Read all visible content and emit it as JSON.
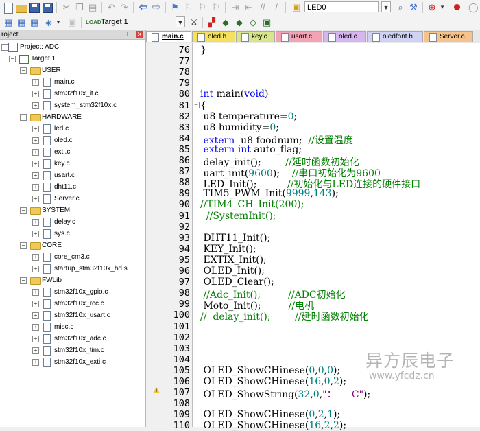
{
  "toolbar": {
    "target_name": "Target 1",
    "run_config": "LED0"
  },
  "project_panel": {
    "title": "roject",
    "pin": "📌",
    "close": "✕",
    "tree": [
      {
        "label": "Project: ADC",
        "kind": "project"
      },
      {
        "label": "Target 1",
        "kind": "target"
      },
      {
        "label": "USER",
        "kind": "folder"
      },
      {
        "label": "main.c",
        "kind": "file"
      },
      {
        "label": "stm32f10x_it.c",
        "kind": "file"
      },
      {
        "label": "system_stm32f10x.c",
        "kind": "file"
      },
      {
        "label": "HARDWARE",
        "kind": "folder"
      },
      {
        "label": "led.c",
        "kind": "file"
      },
      {
        "label": "oled.c",
        "kind": "file"
      },
      {
        "label": "exti.c",
        "kind": "file"
      },
      {
        "label": "key.c",
        "kind": "file"
      },
      {
        "label": "usart.c",
        "kind": "file"
      },
      {
        "label": "dht11.c",
        "kind": "file"
      },
      {
        "label": "Server.c",
        "kind": "file"
      },
      {
        "label": "SYSTEM",
        "kind": "folder"
      },
      {
        "label": "delay.c",
        "kind": "file"
      },
      {
        "label": "sys.c",
        "kind": "file"
      },
      {
        "label": "CORE",
        "kind": "folder"
      },
      {
        "label": "core_cm3.c",
        "kind": "file"
      },
      {
        "label": "startup_stm32f10x_hd.s",
        "kind": "file"
      },
      {
        "label": "FWLib",
        "kind": "folder"
      },
      {
        "label": "stm32f10x_gpio.c",
        "kind": "file"
      },
      {
        "label": "stm32f10x_rcc.c",
        "kind": "file"
      },
      {
        "label": "stm32f10x_usart.c",
        "kind": "file"
      },
      {
        "label": "misc.c",
        "kind": "file"
      },
      {
        "label": "stm32f10x_adc.c",
        "kind": "file"
      },
      {
        "label": "stm32f10x_tim.c",
        "kind": "file"
      },
      {
        "label": "stm32f10x_exti.c",
        "kind": "file"
      }
    ]
  },
  "tabs": [
    {
      "label": "main.c",
      "color": "#f5c97a",
      "active": true
    },
    {
      "label": "oled.h",
      "color": "#f5e15e",
      "active": false
    },
    {
      "label": "key.c",
      "color": "#d8e58a",
      "active": false
    },
    {
      "label": "usart.c",
      "color": "#f3a3b4",
      "active": false
    },
    {
      "label": "oled.c",
      "color": "#d6b6ee",
      "active": false
    },
    {
      "label": "oledfont.h",
      "color": "#cfd2f2",
      "active": false
    },
    {
      "label": "Server.c",
      "color": "#f6c48a",
      "active": false
    }
  ],
  "editor": {
    "lines": [
      {
        "n": "76",
        "segs": [
          {
            "t": "}",
            "c": ""
          }
        ]
      },
      {
        "n": "77",
        "segs": []
      },
      {
        "n": "78",
        "segs": []
      },
      {
        "n": "79",
        "segs": []
      },
      {
        "n": "80",
        "segs": [
          {
            "t": "int",
            "c": "k"
          },
          {
            "t": " main(",
            "c": ""
          },
          {
            "t": "void",
            "c": "k"
          },
          {
            "t": ")",
            "c": ""
          }
        ]
      },
      {
        "n": "81",
        "segs": [
          {
            "t": "{",
            "c": ""
          }
        ]
      },
      {
        "n": "82",
        "segs": [
          {
            "t": " u8 temperature=",
            "c": ""
          },
          {
            "t": "0",
            "c": "n"
          },
          {
            "t": ";",
            "c": ""
          }
        ]
      },
      {
        "n": "83",
        "segs": [
          {
            "t": " u8 humidity=",
            "c": ""
          },
          {
            "t": "0",
            "c": "n"
          },
          {
            "t": ";",
            "c": ""
          }
        ]
      },
      {
        "n": "84",
        "segs": [
          {
            "t": " ",
            "c": ""
          },
          {
            "t": "extern",
            "c": "k"
          },
          {
            "t": "  u8 foodnum;  ",
            "c": ""
          },
          {
            "t": "//设置温度",
            "c": "c"
          }
        ]
      },
      {
        "n": "85",
        "segs": [
          {
            "t": " ",
            "c": ""
          },
          {
            "t": "extern",
            "c": "k"
          },
          {
            "t": " ",
            "c": ""
          },
          {
            "t": "int",
            "c": "k"
          },
          {
            "t": " auto_flag;",
            "c": ""
          }
        ]
      },
      {
        "n": "86",
        "segs": [
          {
            "t": " delay_init();        ",
            "c": ""
          },
          {
            "t": "//延时函数初始化",
            "c": "c"
          }
        ]
      },
      {
        "n": "87",
        "segs": [
          {
            "t": " uart_init(",
            "c": ""
          },
          {
            "t": "9600",
            "c": "n"
          },
          {
            "t": ");    ",
            "c": ""
          },
          {
            "t": "//串口初始化为9600",
            "c": "c"
          }
        ]
      },
      {
        "n": "88",
        "segs": [
          {
            "t": " LED_Init();          ",
            "c": ""
          },
          {
            "t": "//初始化与LED连接的硬件接口",
            "c": "c"
          }
        ]
      },
      {
        "n": "89",
        "segs": [
          {
            "t": " TIM5_PWM_Init(",
            "c": ""
          },
          {
            "t": "9999",
            "c": "n"
          },
          {
            "t": ",",
            "c": ""
          },
          {
            "t": "143",
            "c": "n"
          },
          {
            "t": ");",
            "c": ""
          }
        ]
      },
      {
        "n": "90",
        "segs": [
          {
            "t": "//TIM4_CH_Init(200);",
            "c": "c"
          }
        ]
      },
      {
        "n": "91",
        "segs": [
          {
            "t": "  //SystemInit();",
            "c": "c"
          }
        ]
      },
      {
        "n": "92",
        "segs": []
      },
      {
        "n": "93",
        "segs": [
          {
            "t": " DHT11_Init();",
            "c": ""
          }
        ]
      },
      {
        "n": "94",
        "segs": [
          {
            "t": " KEY_Init();",
            "c": ""
          }
        ]
      },
      {
        "n": "95",
        "segs": [
          {
            "t": " EXTIX_Init();",
            "c": ""
          }
        ]
      },
      {
        "n": "96",
        "segs": [
          {
            "t": " OLED_Init();",
            "c": ""
          }
        ]
      },
      {
        "n": "97",
        "segs": [
          {
            "t": " OLED_Clear();",
            "c": ""
          }
        ]
      },
      {
        "n": "98",
        "segs": [
          {
            "t": " //Adc_Init();         //ADC初始化",
            "c": "c"
          }
        ]
      },
      {
        "n": "99",
        "segs": [
          {
            "t": " Moto_Init();         ",
            "c": ""
          },
          {
            "t": "//电机",
            "c": "c"
          }
        ]
      },
      {
        "n": "100",
        "segs": [
          {
            "t": "//  delay_init();        //延时函数初始化",
            "c": "c"
          }
        ]
      },
      {
        "n": "101",
        "segs": []
      },
      {
        "n": "102",
        "segs": []
      },
      {
        "n": "103",
        "segs": []
      },
      {
        "n": "104",
        "segs": []
      },
      {
        "n": "105",
        "segs": [
          {
            "t": " OLED_ShowCHinese(",
            "c": ""
          },
          {
            "t": "0",
            "c": "n"
          },
          {
            "t": ",",
            "c": ""
          },
          {
            "t": "0",
            "c": "n"
          },
          {
            "t": ",",
            "c": ""
          },
          {
            "t": "0",
            "c": "n"
          },
          {
            "t": ");",
            "c": ""
          }
        ]
      },
      {
        "n": "106",
        "segs": [
          {
            "t": " OLED_ShowCHinese(",
            "c": ""
          },
          {
            "t": "16",
            "c": "n"
          },
          {
            "t": ",",
            "c": ""
          },
          {
            "t": "0",
            "c": "n"
          },
          {
            "t": ",",
            "c": ""
          },
          {
            "t": "2",
            "c": "n"
          },
          {
            "t": ");",
            "c": ""
          }
        ]
      },
      {
        "n": "107",
        "segs": [
          {
            "t": " OLED_ShowString(",
            "c": ""
          },
          {
            "t": "32",
            "c": "n"
          },
          {
            "t": ",",
            "c": ""
          },
          {
            "t": "0",
            "c": "n"
          },
          {
            "t": ",",
            "c": ""
          },
          {
            "t": "\"：     C\"",
            "c": "s"
          },
          {
            "t": ");",
            "c": ""
          }
        ]
      },
      {
        "n": "108",
        "segs": []
      },
      {
        "n": "109",
        "segs": [
          {
            "t": " OLED_ShowCHinese(",
            "c": ""
          },
          {
            "t": "0",
            "c": "n"
          },
          {
            "t": ",",
            "c": ""
          },
          {
            "t": "2",
            "c": "n"
          },
          {
            "t": ",",
            "c": ""
          },
          {
            "t": "1",
            "c": "n"
          },
          {
            "t": ");",
            "c": ""
          }
        ]
      },
      {
        "n": "110",
        "segs": [
          {
            "t": " OLED_ShowCHinese(",
            "c": ""
          },
          {
            "t": "16",
            "c": "n"
          },
          {
            "t": ",",
            "c": ""
          },
          {
            "t": "2",
            "c": "n"
          },
          {
            "t": ",",
            "c": ""
          },
          {
            "t": "2",
            "c": "n"
          },
          {
            "t": ");",
            "c": ""
          }
        ]
      }
    ]
  },
  "watermark": {
    "brand": "异方辰电子",
    "url": "www.yfcdz.cn"
  }
}
